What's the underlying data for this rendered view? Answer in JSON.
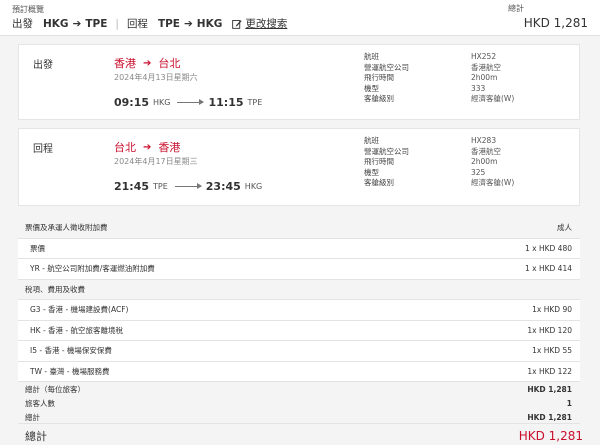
{
  "header": {
    "title": "預訂概覽",
    "outbound_label": "出發",
    "outbound_from": "HKG",
    "outbound_to": "TPE",
    "return_label": "回程",
    "return_from": "TPE",
    "return_to": "HKG",
    "edit_label": "更改搜索",
    "total_label": "總計",
    "total_value": "HKD 1,281"
  },
  "outbound": {
    "direction": "出發",
    "from_city": "香港",
    "to_city": "台北",
    "date": "2024年4月13日星期六",
    "dep_time": "09:15",
    "dep_airport": "HKG",
    "arr_time": "11:15",
    "arr_airport": "TPE",
    "details": [
      {
        "label": "航班",
        "value": "HX252"
      },
      {
        "label": "營運航空公司",
        "value": "香港航空"
      },
      {
        "label": "飛行時間",
        "value": "2h00m"
      },
      {
        "label": "機型",
        "value": "333"
      },
      {
        "label": "客艙級別",
        "value": "經濟客艙(W)"
      }
    ]
  },
  "return": {
    "direction": "回程",
    "from_city": "台北",
    "to_city": "香港",
    "date": "2024年4月17日星期三",
    "dep_time": "21:45",
    "dep_airport": "TPE",
    "arr_time": "23:45",
    "arr_airport": "HKG",
    "details": [
      {
        "label": "航班",
        "value": "HX283"
      },
      {
        "label": "營運航空公司",
        "value": "香港航空"
      },
      {
        "label": "飛行時間",
        "value": "2h00m"
      },
      {
        "label": "機型",
        "value": "325"
      },
      {
        "label": "客艙級別",
        "value": "經濟客艙(W)"
      }
    ]
  },
  "fare": {
    "section1_title": "票價及承運人徵收附加費",
    "section1_right": "成人",
    "fare_label": "票價",
    "fare_value": "1 x HKD 480",
    "yr_label": "YR - 航空公司附加費/客運燃油附加費",
    "yr_value": "1 x HKD 414",
    "section2_title": "稅項、費用及收費",
    "taxes": [
      {
        "label": "G3 - 香港 - 機場建設費(ACF)",
        "value": "1x HKD 90"
      },
      {
        "label": "HK - 香港 - 航空旅客離境稅",
        "value": "1x HKD 120"
      },
      {
        "label": "I5 - 香港 - 機場保安保費",
        "value": "1x HKD 55"
      },
      {
        "label": "TW - 臺灣 - 機場服務費",
        "value": "1x HKD 122"
      }
    ],
    "per_pax_label": "總計（每位旅客）",
    "per_pax_value": "HKD 1,281",
    "pax_count_label": "旅客人數",
    "pax_count_value": "1",
    "subtotal_label": "總計",
    "subtotal_value": "HKD 1,281",
    "grand_label": "總計",
    "grand_value": "HKD 1,281"
  },
  "colors": {
    "accent_red": "#c8102e"
  },
  "icons": {
    "edit": "edit-icon",
    "arrow": "arrow-right-icon"
  }
}
